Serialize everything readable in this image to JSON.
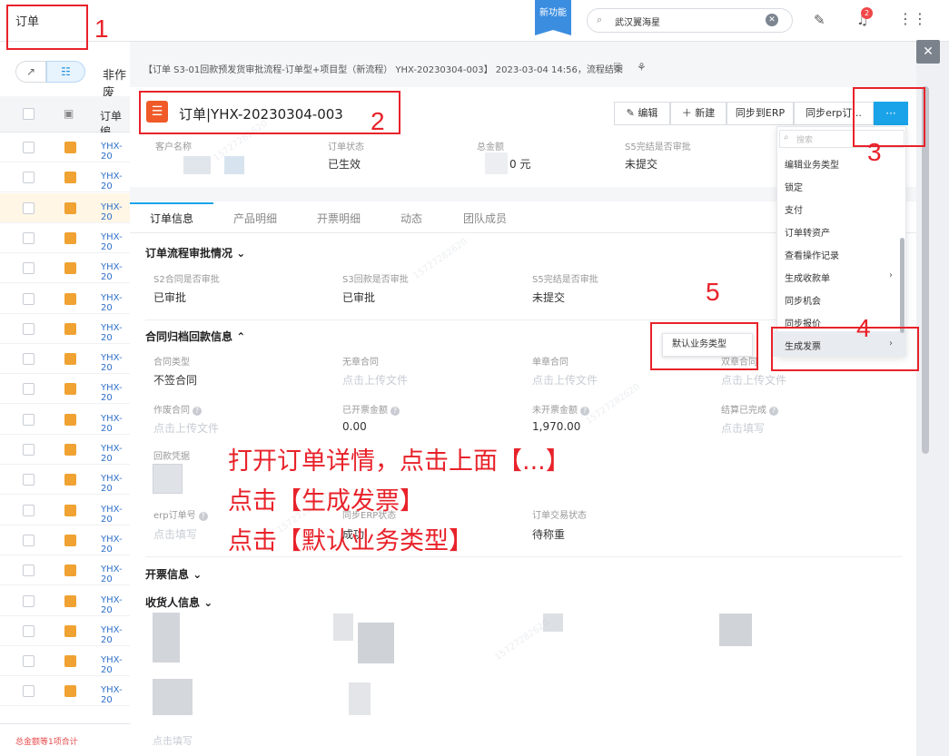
{
  "top": {
    "title": "订单",
    "new_feature": "新功能",
    "search_value": "武汉翼海星",
    "badge": "2"
  },
  "list": {
    "tab_label": "非作废",
    "col_header": "订单编",
    "rows": [
      "YHX-20",
      "YHX-20",
      "YHX-20",
      "YHX-20",
      "YHX-20",
      "YHX-20",
      "YHX-20",
      "YHX-20",
      "YHX-20",
      "YHX-20",
      "YHX-20",
      "YHX-20",
      "YHX-20",
      "YHX-20",
      "YHX-20",
      "YHX-20",
      "YHX-20",
      "YHX-20",
      "YHX-20"
    ],
    "footer": "总金额等1项合计"
  },
  "panel": {
    "breadcrumb": "【订单 S3-01回款预发货审批流程-订单型+项目型（新流程） YHX-20230304-003】 2023-03-04 14:56，流程结束",
    "title": "订单|YHX-20230304-003",
    "buttons": {
      "edit": "编辑",
      "new": "新建",
      "sync_erp": "同步到ERP",
      "sync_erp2": "同步erp订...",
      "more": "···"
    },
    "summary": [
      {
        "label": "客户名称",
        "value": ""
      },
      {
        "label": "订单状态",
        "value": "已生效"
      },
      {
        "label": "总金额",
        "value": "0 元"
      },
      {
        "label": "S5完结是否审批",
        "value": "未提交"
      }
    ],
    "tabs": [
      "订单信息",
      "产品明细",
      "开票明细",
      "动态",
      "团队成员"
    ],
    "approval": {
      "title": "订单流程审批情况",
      "fields": [
        {
          "label": "S2合同是否审批",
          "value": "已审批"
        },
        {
          "label": "S3回款是否审批",
          "value": "已审批"
        },
        {
          "label": "S5完结是否审批",
          "value": "未提交"
        }
      ]
    },
    "contract": {
      "title": "合同归档回款信息",
      "row1": [
        {
          "label": "合同类型",
          "value": "不签合同"
        },
        {
          "label": "无章合同",
          "value": "点击上传文件"
        },
        {
          "label": "单章合同",
          "value": "点击上传文件"
        },
        {
          "label": "双章合同",
          "value": "点击上传文件"
        }
      ],
      "row2": [
        {
          "label": "作废合同",
          "value": "点击上传文件"
        },
        {
          "label": "已开票金额",
          "value": "0.00"
        },
        {
          "label": "未开票金额",
          "value": "1,970.00"
        },
        {
          "label": "结算已完成",
          "value": "点击填写"
        }
      ],
      "receipt_label": "回款凭据",
      "row3": [
        {
          "label": "erp订单号",
          "value": "点击填写"
        },
        {
          "label": "同步ERP状态",
          "value": "成功"
        },
        {
          "label": "订单交易状态",
          "value": "待称重"
        }
      ]
    },
    "invoice_title": "开票信息",
    "receiver_title": "收货人信息",
    "bottom_hint": "点击填写"
  },
  "dropdown": {
    "search_placeholder": "搜索",
    "items": [
      "编辑业务类型",
      "锁定",
      "支付",
      "订单转资产",
      "查看操作记录",
      "生成收款单",
      "同步机会",
      "同步报价",
      "生成发票"
    ]
  },
  "popup": {
    "label": "默认业务类型"
  },
  "annotation": {
    "line1": "打开订单详情，点击上面【...】",
    "line2": "点击【生成发票】",
    "line3": "点击【默认业务类型】",
    "nums": [
      "1",
      "2",
      "3",
      "4",
      "5"
    ]
  },
  "colors": {
    "accent": "#1aa3e8",
    "annotation_red": "#e8222a",
    "link_blue": "#2d6fc9",
    "title_icon": "#f05a28"
  }
}
